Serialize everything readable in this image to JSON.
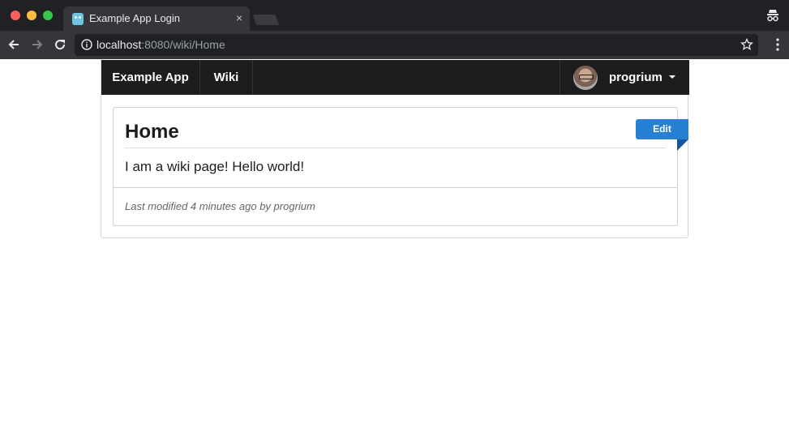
{
  "browser": {
    "tab_title": "Example App Login",
    "tab_close": "×",
    "url_host": "localhost",
    "url_rest": ":8080/wiki/Home"
  },
  "navbar": {
    "brand": "Example App",
    "wiki_link": "Wiki",
    "username": "progrium"
  },
  "page": {
    "title": "Home",
    "body": "I am a wiki page! Hello world!",
    "edit_label": "Edit",
    "footer": "Last modified 4 minutes ago by progrium"
  },
  "colors": {
    "accent": "#2780d4",
    "navbar": "#1c1d1f"
  }
}
